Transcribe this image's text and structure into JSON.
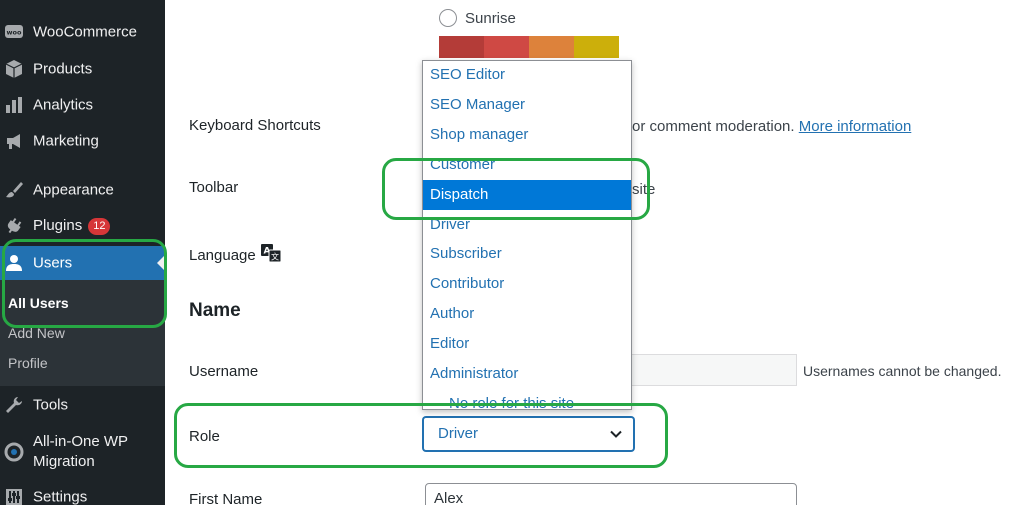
{
  "sidebar": {
    "items": [
      {
        "label": "WooCommerce",
        "icon": "woocommerce-icon"
      },
      {
        "label": "Products",
        "icon": "box-icon"
      },
      {
        "label": "Analytics",
        "icon": "bar-chart-icon"
      },
      {
        "label": "Marketing",
        "icon": "megaphone-icon"
      },
      {
        "label": "Appearance",
        "icon": "paintbrush-icon"
      },
      {
        "label": "Plugins",
        "icon": "plug-icon",
        "badge": "12"
      },
      {
        "label": "Users",
        "icon": "user-icon",
        "active": true
      },
      {
        "label": "Tools",
        "icon": "wrench-icon"
      },
      {
        "label_line1": "All-in-One WP",
        "label_line2": "Migration",
        "icon": "migration-icon"
      },
      {
        "label": "Settings",
        "icon": "settings-sliders-icon"
      }
    ],
    "submenu": {
      "all_users": "All Users",
      "add_new": "Add New",
      "profile": "Profile"
    }
  },
  "form": {
    "color_scheme_option": "Sunrise",
    "swatch_colors": [
      "#b43c38",
      "#cf4944",
      "#dd823b",
      "#ccaf0b"
    ],
    "keyboard_shortcuts_label": "Keyboard Shortcuts",
    "keyboard_shortcuts_desc": "or comment moderation.",
    "more_information": "More information",
    "toolbar_label": "Toolbar",
    "toolbar_desc": "site",
    "language_label": "Language",
    "name_heading": "Name",
    "username_label": "Username",
    "username_note": "Usernames cannot be changed.",
    "role_label": "Role",
    "role_value": "Driver",
    "first_name_label": "First Name",
    "first_name_value": "Alex"
  },
  "role_dropdown": {
    "options": [
      "SEO Editor",
      "SEO Manager",
      "Shop manager",
      "Customer",
      "Dispatch",
      "Driver",
      "Subscriber",
      "Contributor",
      "Author",
      "Editor",
      "Administrator",
      "No role for this site"
    ],
    "highlighted": "Dispatch"
  },
  "colors": {
    "sidebar_bg": "#1d2327",
    "active_bg": "#2271b1",
    "link": "#2271b1",
    "option_selected": "#0078d7",
    "highlight_outline": "#27a844"
  }
}
